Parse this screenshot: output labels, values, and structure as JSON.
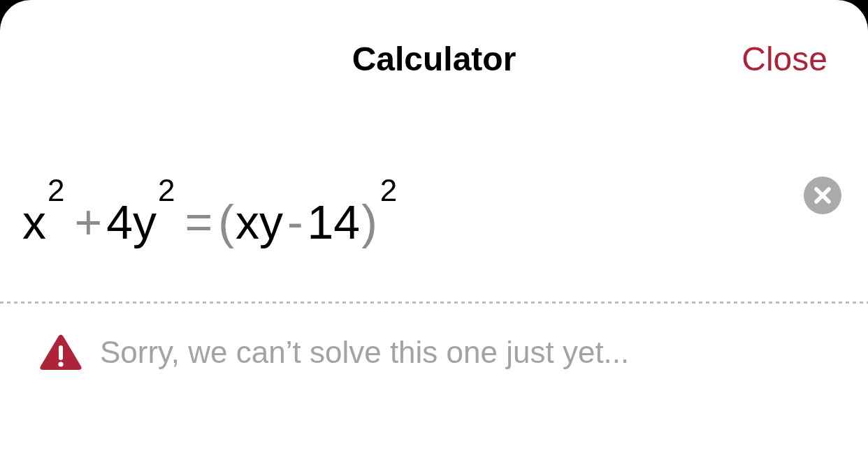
{
  "header": {
    "title": "Calculator",
    "close_button": "Close"
  },
  "equation": {
    "tokens": [
      {
        "kind": "term",
        "text": "x"
      },
      {
        "kind": "exponent",
        "text": "2"
      },
      {
        "kind": "operator",
        "text": "+"
      },
      {
        "kind": "term",
        "text": "4y"
      },
      {
        "kind": "exponent",
        "text": "2"
      },
      {
        "kind": "operator",
        "text": "="
      },
      {
        "kind": "paren",
        "text": "("
      },
      {
        "kind": "term",
        "text": "xy"
      },
      {
        "kind": "operator",
        "text": "-"
      },
      {
        "kind": "term",
        "text": "14"
      },
      {
        "kind": "paren",
        "text": ")"
      },
      {
        "kind": "exponent",
        "text": "2"
      }
    ]
  },
  "message": {
    "kind": "warning",
    "text": "Sorry, we can’t solve this one just yet..."
  }
}
